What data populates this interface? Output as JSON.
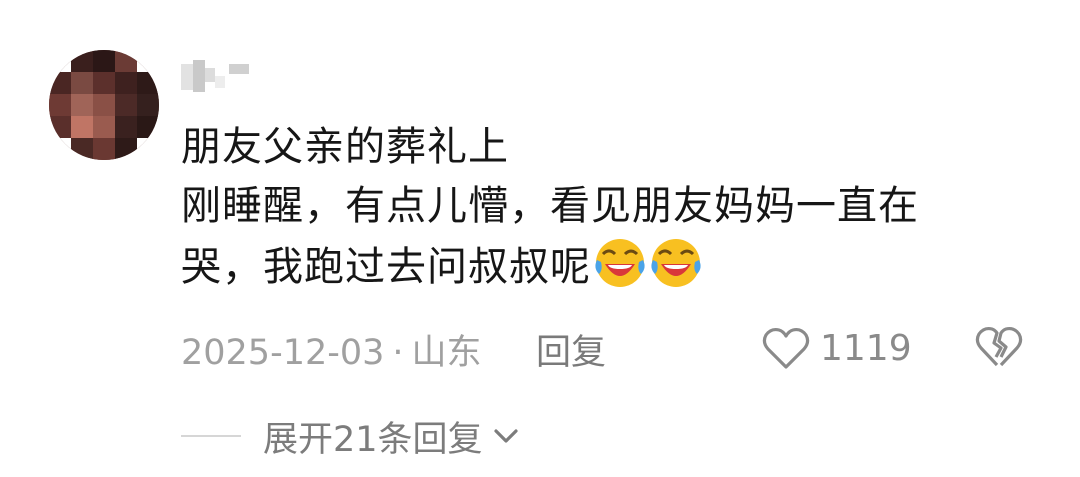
{
  "comment": {
    "text_lines": [
      "朋友父亲的葬礼上",
      "刚睡醒，有点儿懵，看见朋友妈妈一直在",
      "哭，我跑过去问叔叔呢"
    ],
    "trailing_emoji": [
      "laughing-crying-emoji",
      "laughing-crying-emoji"
    ],
    "date": "2025-12-03",
    "separator": "·",
    "location": "山东",
    "reply_label": "回复",
    "like_count": "1119",
    "expand_label": "展开21条回复"
  },
  "icons": {
    "like": "heart-outline-icon",
    "dislike": "broken-heart-icon",
    "expand": "chevron-down-icon"
  },
  "colors": {
    "text_primary": "#161616",
    "text_meta": "#a0a0a0",
    "icon": "#8a8a8a",
    "emoji_face": "#f8c021",
    "emoji_mouth": "#d9373a",
    "emoji_tear": "#4aa3e8"
  }
}
